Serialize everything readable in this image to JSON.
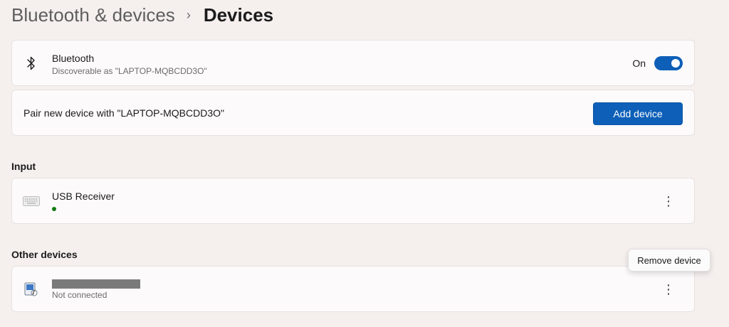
{
  "breadcrumb": {
    "parent": "Bluetooth & devices",
    "separator": "›",
    "current": "Devices"
  },
  "bluetooth": {
    "icon": "bluetooth-icon",
    "title": "Bluetooth",
    "subtitle": "Discoverable as \"LAPTOP-MQBCDD3O\"",
    "toggle_label": "On",
    "toggle_on": true
  },
  "pair": {
    "text": "Pair new device with \"LAPTOP-MQBCDD3O\"",
    "button_label": "Add device"
  },
  "sections": {
    "input": "Input",
    "other": "Other devices"
  },
  "input_devices": [
    {
      "icon": "keyboard-icon",
      "name": "USB Receiver",
      "status": "connected"
    }
  ],
  "other_devices": [
    {
      "icon": "media-device-icon",
      "name": "",
      "status_text": "Not connected"
    }
  ],
  "more_glyph": "⋮",
  "context_menu": {
    "items": [
      "Remove device"
    ]
  },
  "colors": {
    "accent": "#0d5fb8",
    "status_green": "#107c10",
    "background": "#f5efee",
    "card": "#fcfafa"
  }
}
